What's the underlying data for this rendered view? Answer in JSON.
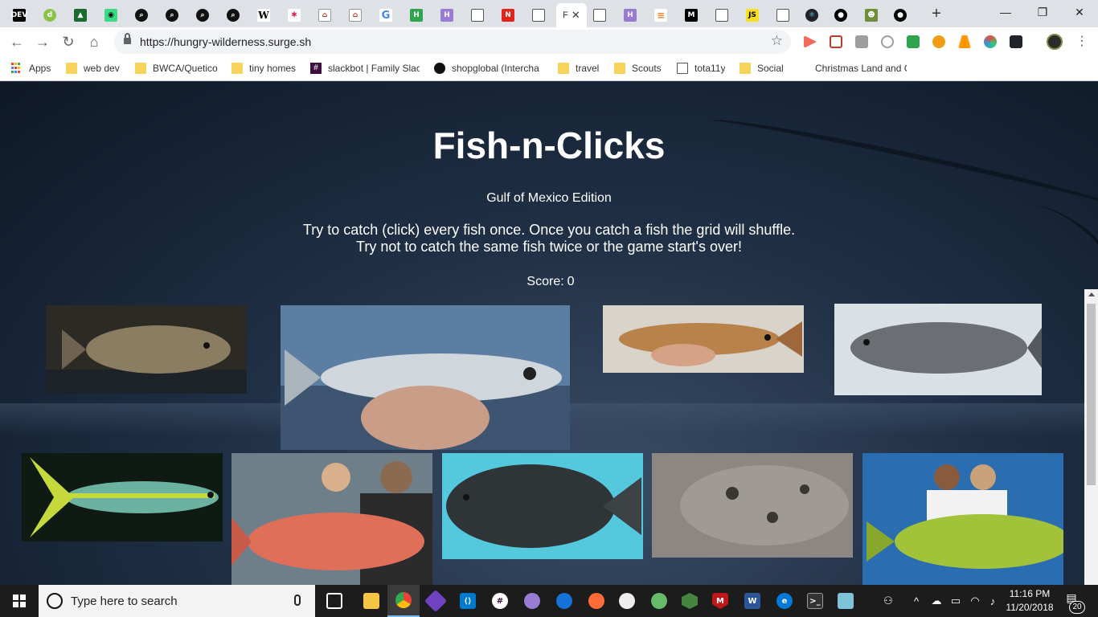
{
  "browser": {
    "url": "https://hungry-wilderness.surge.sh",
    "active_tab_label": "F",
    "tab_close": "✕",
    "new_tab": "+",
    "window_controls": {
      "minimize": "—",
      "restore": "❐",
      "close": "✕"
    }
  },
  "bookmarks": [
    {
      "label": "Apps",
      "icon": "apps-grid-icon"
    },
    {
      "label": "web dev",
      "icon": "folder-icon"
    },
    {
      "label": "BWCA/Quetico",
      "icon": "folder-icon"
    },
    {
      "label": "tiny homes",
      "icon": "folder-icon"
    },
    {
      "label": "slackbot | Family Slac",
      "icon": "slack-icon"
    },
    {
      "label": "shopglobal (Intercha",
      "icon": "github-icon"
    },
    {
      "label": "travel",
      "icon": "folder-icon"
    },
    {
      "label": "Scouts",
      "icon": "folder-icon"
    },
    {
      "label": "tota11y",
      "icon": "page-icon"
    },
    {
      "label": "Social",
      "icon": "folder-icon"
    },
    {
      "label": "Christmas Land and C",
      "icon": "none"
    }
  ],
  "game": {
    "title": "Fish-n-Clicks",
    "subtitle": "Gulf of Mexico Edition",
    "instructions_line1": "Try to catch (click) every fish once. Once you catch a fish the grid will shuffle.",
    "instructions_line2": "Try not to catch the same fish twice or the game start's over!",
    "score_label": "Score:",
    "score_value": "0"
  },
  "fish_cards": [
    {
      "name": "grouper",
      "colors": [
        "#2c2a24",
        "#8a7d62"
      ]
    },
    {
      "name": "spanish-mackerel",
      "colors": [
        "#5d7ea3",
        "#cfd6dc"
      ]
    },
    {
      "name": "redfish",
      "colors": [
        "#d8d4cc",
        "#b9824a"
      ]
    },
    {
      "name": "gag-grouper",
      "colors": [
        "#d9e0e6",
        "#6b6e73"
      ]
    },
    {
      "name": "yellowtail-snapper",
      "colors": [
        "#0f1a12",
        "#c5d93c"
      ]
    },
    {
      "name": "red-snapper",
      "colors": [
        "#6f7f8a",
        "#e06f5a"
      ]
    },
    {
      "name": "southern-flounder",
      "colors": [
        "#54c9dd",
        "#2f3436"
      ]
    },
    {
      "name": "gulf-flounder",
      "colors": [
        "#8c8783",
        "#a09a95"
      ]
    },
    {
      "name": "mahi-mahi",
      "colors": [
        "#2a6db0",
        "#a2c23a"
      ]
    }
  ],
  "taskbar": {
    "search_placeholder": "Type here to search",
    "time": "11:16 PM",
    "date": "11/20/2018",
    "notifications": "20"
  }
}
